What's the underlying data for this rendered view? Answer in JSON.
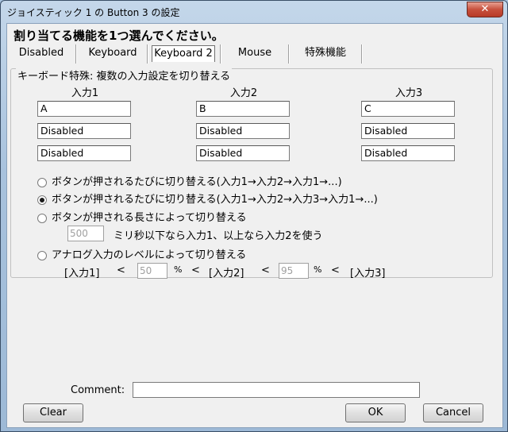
{
  "window": {
    "title": "ジョイスティック 1 の Button 3 の設定",
    "close_label": "✕"
  },
  "instruction": "割り当てる機能を1つ選んでください。",
  "tabs": [
    {
      "label": "Disabled"
    },
    {
      "label": "Keyboard"
    },
    {
      "label": "Keyboard 2"
    },
    {
      "label": "Mouse"
    },
    {
      "label": "特殊機能"
    }
  ],
  "group": {
    "legend": "キーボード特殊: 複数の入力設定を切り替える",
    "columns": [
      {
        "header": "入力1",
        "values": [
          "A",
          "Disabled",
          "Disabled"
        ]
      },
      {
        "header": "入力2",
        "values": [
          "B",
          "Disabled",
          "Disabled"
        ]
      },
      {
        "header": "入力3",
        "values": [
          "C",
          "Disabled",
          "Disabled"
        ]
      }
    ],
    "options": [
      {
        "label": "ボタンが押されるたびに切り替える(入力1→入力2→入力1→...)",
        "selected": false
      },
      {
        "label": "ボタンが押されるたびに切り替える(入力1→入力2→入力3→入力1→...)",
        "selected": true
      },
      {
        "label": "ボタンが押される長さによって切り替える",
        "selected": false
      },
      {
        "label": "アナログ入力のレベルによって切り替える",
        "selected": false
      }
    ],
    "duration": {
      "value": "500",
      "suffix": "ミリ秒以下なら入力1、以上なら入力2を使う"
    },
    "analog": {
      "in1": "[入力1]",
      "lt1": "<",
      "v1": "50",
      "pct1": "%",
      "lt2": "<",
      "in2": "[入力2]",
      "lt3": "<",
      "v2": "95",
      "pct2": "%",
      "lt4": "<",
      "in3": "[入力3]"
    }
  },
  "comment": {
    "label": "Comment:",
    "value": ""
  },
  "buttons": {
    "clear": "Clear",
    "ok": "OK",
    "cancel": "Cancel"
  }
}
